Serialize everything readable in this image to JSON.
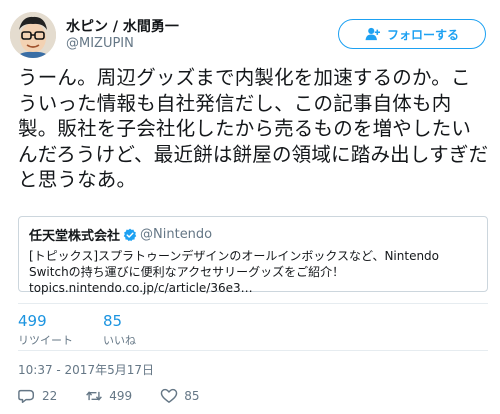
{
  "author": {
    "display_name": "水ピン / 水間勇一",
    "screen_name": "@MIZUPIN",
    "avatar": "avatar-illustration"
  },
  "follow_button": {
    "label": "フォローする",
    "icon": "add-user-icon"
  },
  "tweet": {
    "text": "うーん。周辺グッズまで内製化を加速するのか。こういった情報も自社発信だし、この記事自体も内製。販社を子会社化したから売るものを増やしたいんだろうけど、最近餅は餅屋の領域に踏み出しすぎだと思うなあ。"
  },
  "quoted_tweet": {
    "name": "任天堂株式会社",
    "handle": "@Nintendo",
    "verified_icon": "verified-badge-icon",
    "text": "[トピックス]スプラトゥーンデザインのオールインボックスなど、Nintendo Switchの持ち運びに便利なアクセサリーグッズをご紹介！ topics.nintendo.co.jp/c/article/36e3…"
  },
  "stats": {
    "retweets": {
      "count": "499",
      "label": "リツイート"
    },
    "likes": {
      "count": "85",
      "label": "いいね"
    }
  },
  "timestamp": "10:37 - 2017年5月17日",
  "actions": {
    "reply": {
      "icon": "reply-icon",
      "count": "22"
    },
    "retweet": {
      "icon": "retweet-icon",
      "count": "499"
    },
    "like": {
      "icon": "heart-icon",
      "count": "85"
    }
  },
  "colors": {
    "accent": "#1da1f2",
    "stat_number": "#1c94e0",
    "secondary_text": "#657786",
    "border": "#ccd6dd"
  }
}
